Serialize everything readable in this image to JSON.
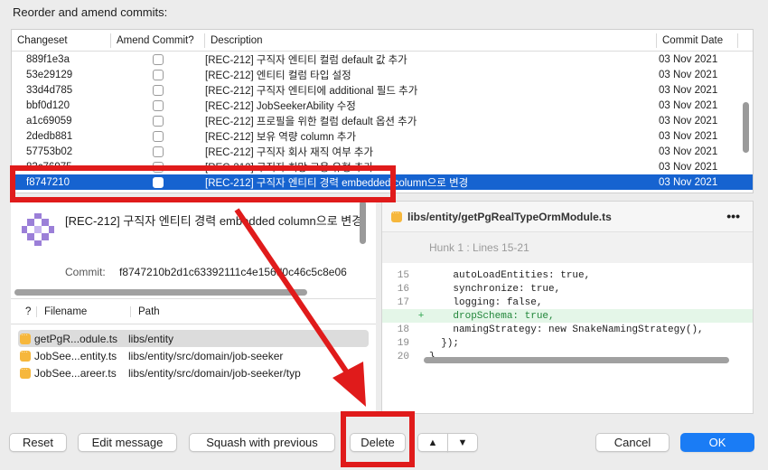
{
  "title": "Reorder and amend commits:",
  "colors": {
    "accent": "#1663d0",
    "annotation": "#e01b1b",
    "ok": "#1a7cf5"
  },
  "commits": {
    "headers": {
      "changeset": "Changeset",
      "amend": "Amend Commit?",
      "description": "Description",
      "date": "Commit Date"
    },
    "rows": [
      {
        "changeset": "889f1e3a",
        "description": "[REC-212] 구직자 엔티티 컬럼 default 값 추가",
        "date": "03 Nov 2021"
      },
      {
        "changeset": "53e29129",
        "description": "[REC-212] 엔티티 컬럼 타입 설정",
        "date": "03 Nov 2021"
      },
      {
        "changeset": "33d4d785",
        "description": "[REC-212] 구직자 엔티티에 additional 필드 추가",
        "date": "03 Nov 2021"
      },
      {
        "changeset": "bbf0d120",
        "description": "[REC-212] JobSeekerAbility 수정",
        "date": "03 Nov 2021"
      },
      {
        "changeset": "a1c69059",
        "description": "[REC-212] 프로필을 위한 컬럼 default 옵션 추가",
        "date": "03 Nov 2021"
      },
      {
        "changeset": "2dedb881",
        "description": "[REC-212] 보유 역량 column 추가",
        "date": "03 Nov 2021"
      },
      {
        "changeset": "57753b02",
        "description": "[REC-212] 구직자 회사 재직 여부 추가",
        "date": "03 Nov 2021"
      },
      {
        "changeset": "83c76975",
        "description": "[REC-212] 구직자 희망 고용 유형 추가",
        "date": "03 Nov 2021"
      },
      {
        "changeset": "f8747210",
        "description": "[REC-212] 구직자 엔티티 경력 embedded column으로 변경",
        "date": "03 Nov 2021",
        "selected": true
      }
    ]
  },
  "detail": {
    "message": "[REC-212] 구직자 엔티티 경력 embedded column으로 변경",
    "commit_label": "Commit:",
    "commit_hash": "f8747210b2d1c63392111c4e156d0c46c5c8e06"
  },
  "files": {
    "headers": {
      "status": "?",
      "filename": "Filename",
      "path": "Path"
    },
    "rows": [
      {
        "filename": "getPgR...odule.ts",
        "path": "libs/entity",
        "selected": true
      },
      {
        "filename": "JobSee...entity.ts",
        "path": "libs/entity/src/domain/job-seeker"
      },
      {
        "filename": "JobSee...areer.ts",
        "path": "libs/entity/src/domain/job-seeker/typ"
      }
    ]
  },
  "diff": {
    "file": "libs/entity/getPgRealTypeOrmModule.ts",
    "more": "•••",
    "hunk": "Hunk 1 : Lines 15-21",
    "lines": [
      {
        "n": "15",
        "m": "",
        "t": "    autoLoadEntities: true,"
      },
      {
        "n": "16",
        "m": "",
        "t": "    synchronize: true,"
      },
      {
        "n": "17",
        "m": "",
        "t": "    logging: false,"
      },
      {
        "n": "",
        "m": "+",
        "t": "    dropSchema: true,",
        "added": true
      },
      {
        "n": "18",
        "m": "",
        "t": "    namingStrategy: new SnakeNamingStrategy(),"
      },
      {
        "n": "19",
        "m": "",
        "t": "  });"
      },
      {
        "n": "20",
        "m": "",
        "t": "}"
      }
    ]
  },
  "buttons": {
    "reset": "Reset",
    "edit": "Edit message",
    "squash": "Squash with previous",
    "delete": "Delete",
    "up": "▲",
    "down": "▼",
    "cancel": "Cancel",
    "ok": "OK"
  }
}
